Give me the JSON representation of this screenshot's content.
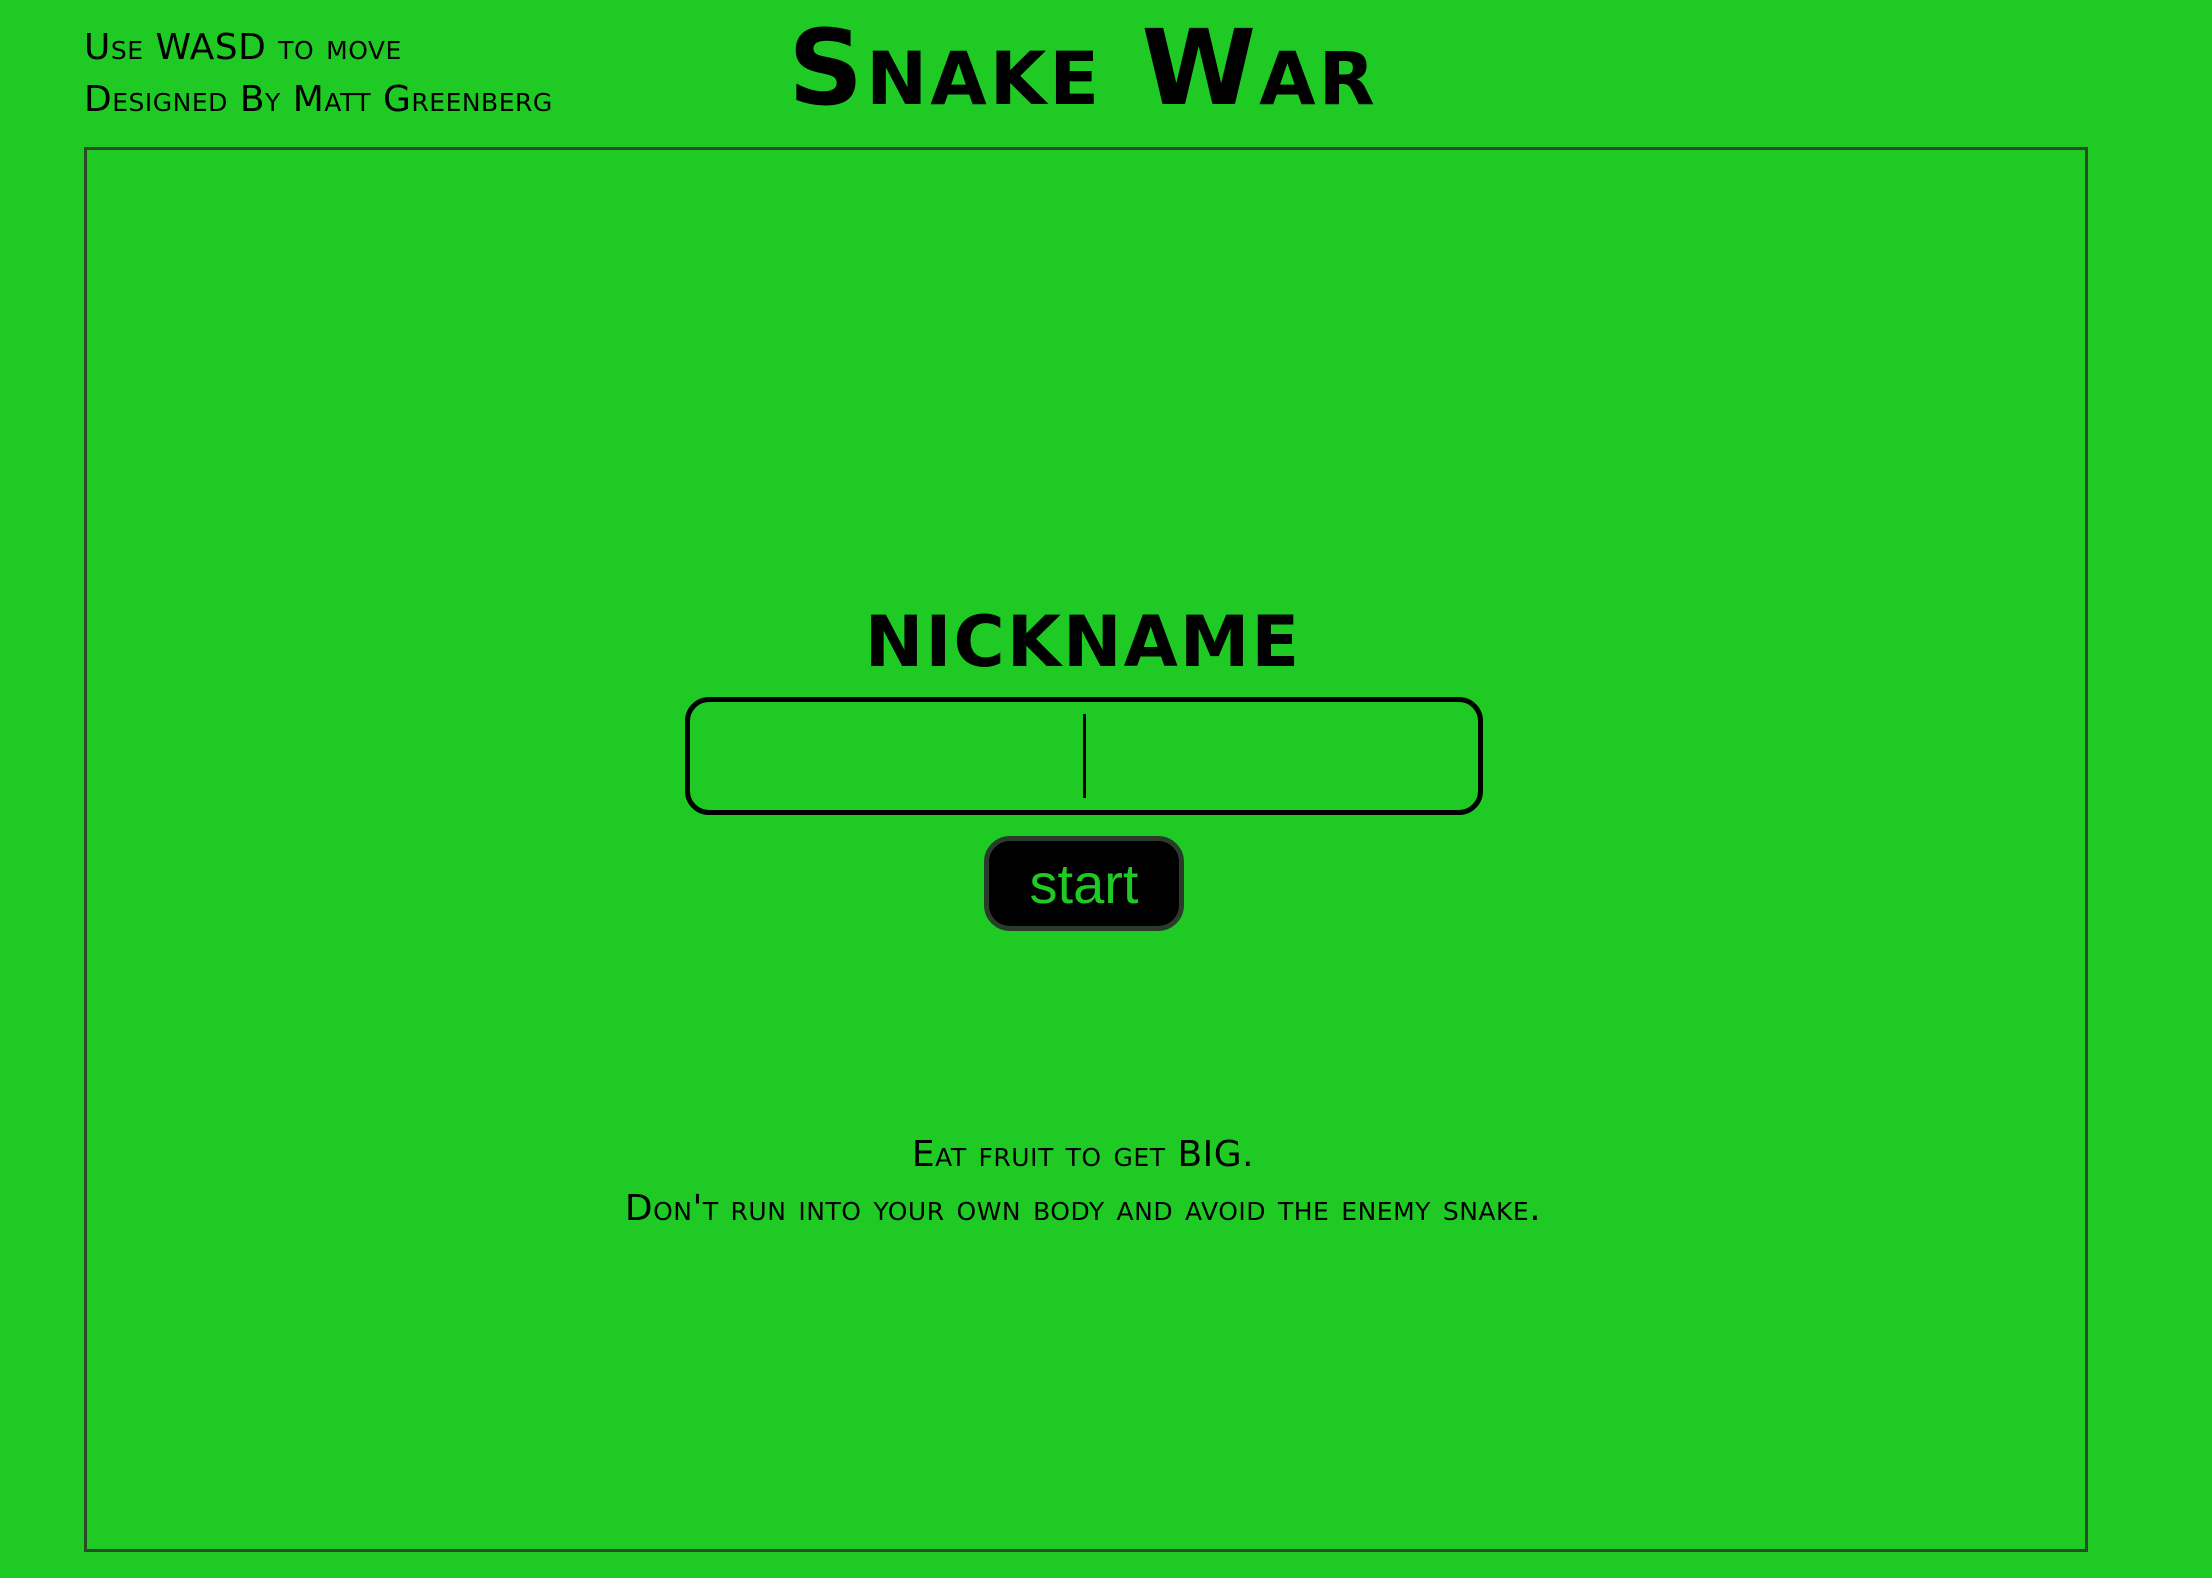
{
  "page": {
    "background_color": "#1fca24"
  },
  "header": {
    "instructions_line1": "Use WASD to move",
    "instructions_line2": "Designed By Matt Greenberg",
    "title": "Snake War"
  },
  "start_screen": {
    "nickname_label": "NICKNAME",
    "nickname_input": {
      "value": "",
      "placeholder": ""
    },
    "start_button_label": "start",
    "start_button_text_color": "#1fca24",
    "rules_line1": "Eat fruit to get BIG.",
    "rules_line2": "Don't run into your own body and avoid the enemy snake."
  }
}
